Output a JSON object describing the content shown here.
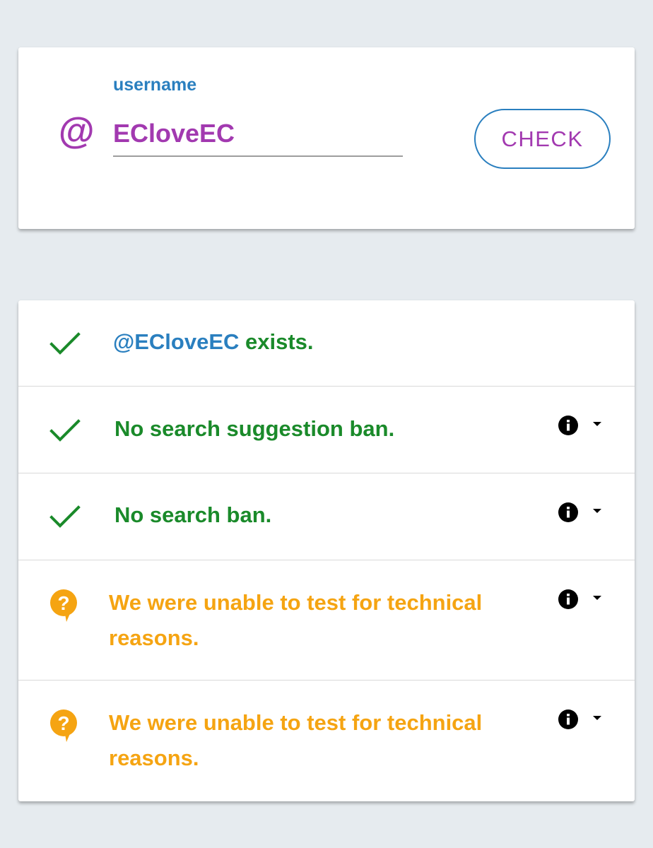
{
  "search": {
    "at_symbol": "@",
    "label": "username",
    "value": "ECloveEC",
    "button_label": "CHECK"
  },
  "results": [
    {
      "status": "success",
      "icon": "check-icon",
      "handle": "@ECloveEC",
      "text": " exists.",
      "has_info": false
    },
    {
      "status": "success",
      "icon": "check-icon",
      "text": "No search suggestion ban.",
      "has_info": true
    },
    {
      "status": "success",
      "icon": "check-icon",
      "text": "No search ban.",
      "has_info": true
    },
    {
      "status": "unknown",
      "icon": "question-bubble-icon",
      "text_line1": "We were unable to test for technical",
      "text_line2": "reasons.",
      "has_info": true
    },
    {
      "status": "unknown",
      "icon": "question-bubble-icon",
      "text_line1": "We were unable to test for technical",
      "text_line2": "reasons.",
      "has_info": true
    }
  ],
  "colors": {
    "background": "#e6ebef",
    "accent_purple": "#a239b0",
    "accent_blue": "#2a7fbf",
    "success_green": "#1a8a2a",
    "warning_orange": "#f5a412"
  }
}
